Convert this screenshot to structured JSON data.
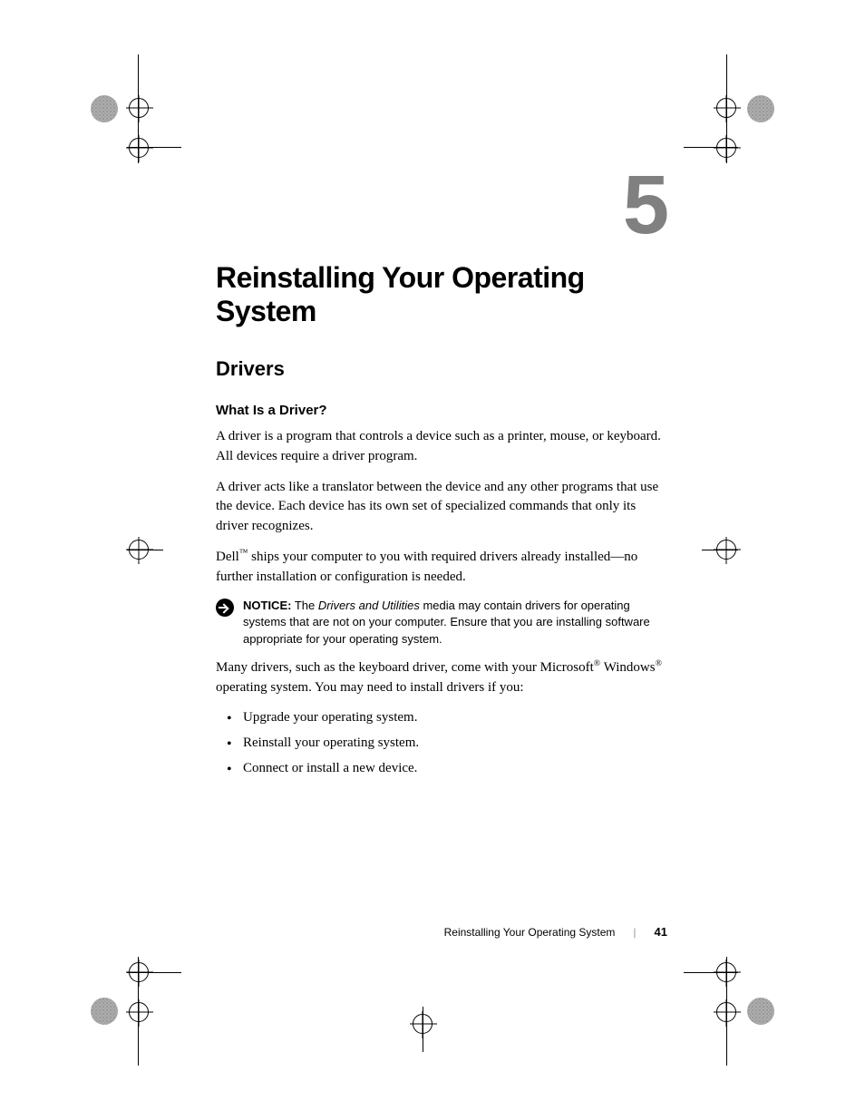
{
  "chapter": {
    "number": "5",
    "title": "Reinstalling Your Operating System"
  },
  "sections": {
    "drivers": {
      "heading": "Drivers",
      "subheading": "What Is a Driver?",
      "p1": "A driver is a program that controls a device such as a printer, mouse, or keyboard. All devices require a driver program.",
      "p2": "A driver acts like a translator between the device and any other programs that use the device. Each device has its own set of specialized commands that only its driver recognizes.",
      "p3_before_tm": "Dell",
      "p3_after_tm": " ships your computer to you with required drivers already installed—no further installation or configuration is needed.",
      "notice": {
        "label": "NOTICE:",
        "text_before_italic": " The ",
        "italic": "Drivers and Utilities",
        "text_after_italic": " media may contain drivers for operating systems that are not on your computer. Ensure that you are installing software appropriate for your operating system."
      },
      "p4_part1": "Many drivers, such as the keyboard driver, come with your Microsoft",
      "p4_part2": " Windows",
      "p4_part3": " operating system. You may need to install drivers if you:",
      "bullets": [
        "Upgrade your operating system.",
        "Reinstall your operating system.",
        "Connect or install a new device."
      ]
    }
  },
  "footer": {
    "title": "Reinstalling Your Operating System",
    "page": "41"
  },
  "symbols": {
    "tm": "™",
    "reg": "®"
  }
}
